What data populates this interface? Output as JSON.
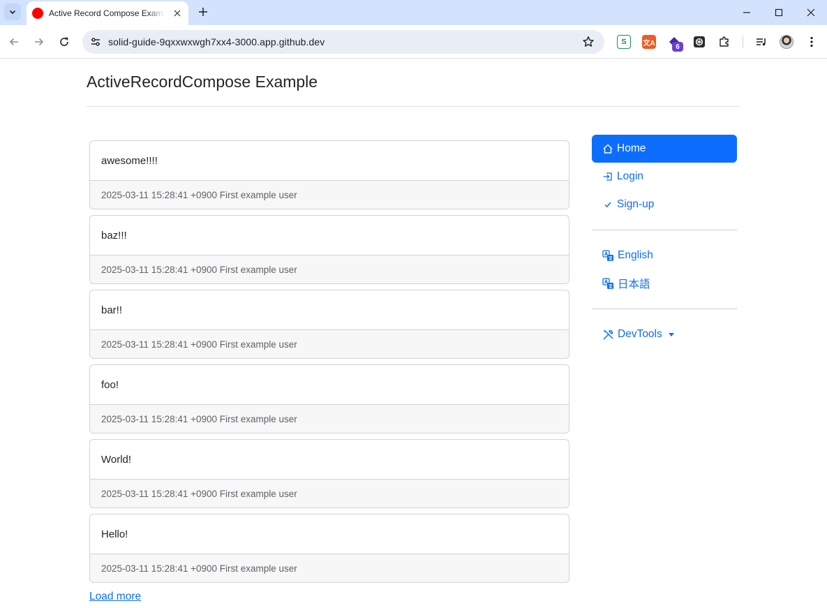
{
  "browser": {
    "tab_title": "Active Record Compose Example",
    "url": "solid-guide-9qxxwxwgh7xx4-3000.app.github.dev",
    "extension_badge": "6",
    "extension_icons": [
      "s-extension-icon",
      "translate-extension-icon",
      "tag-extension-icon",
      "openai-extension-icon",
      "puzzle-extensions-icon",
      "media-queue-icon"
    ]
  },
  "page": {
    "title": "ActiveRecordCompose Example"
  },
  "posts": [
    {
      "body": "awesome!!!!",
      "meta": "2025-03-11 15:28:41 +0900 First example user"
    },
    {
      "body": "baz!!!",
      "meta": "2025-03-11 15:28:41 +0900 First example user"
    },
    {
      "body": "bar!!",
      "meta": "2025-03-11 15:28:41 +0900 First example user"
    },
    {
      "body": "foo!",
      "meta": "2025-03-11 15:28:41 +0900 First example user"
    },
    {
      "body": "World!",
      "meta": "2025-03-11 15:28:41 +0900 First example user"
    },
    {
      "body": "Hello!",
      "meta": "2025-03-11 15:28:41 +0900 First example user"
    }
  ],
  "load_more": "Load more",
  "sidebar": {
    "nav": [
      {
        "label": "Home",
        "icon": "house-icon",
        "active": true
      },
      {
        "label": "Login",
        "icon": "box-arrow-in-icon",
        "active": false
      },
      {
        "label": "Sign-up",
        "icon": "check-icon",
        "active": false
      }
    ],
    "languages": [
      {
        "label": "English",
        "icon": "translate-icon"
      },
      {
        "label": "日本語",
        "icon": "translate-icon"
      }
    ],
    "devtools": {
      "label": "DevTools",
      "icon": "tools-icon"
    }
  },
  "colors": {
    "primary": "#0d6efd",
    "tabbar": "#d3e3fd",
    "card_footer": "#f7f7f7"
  }
}
